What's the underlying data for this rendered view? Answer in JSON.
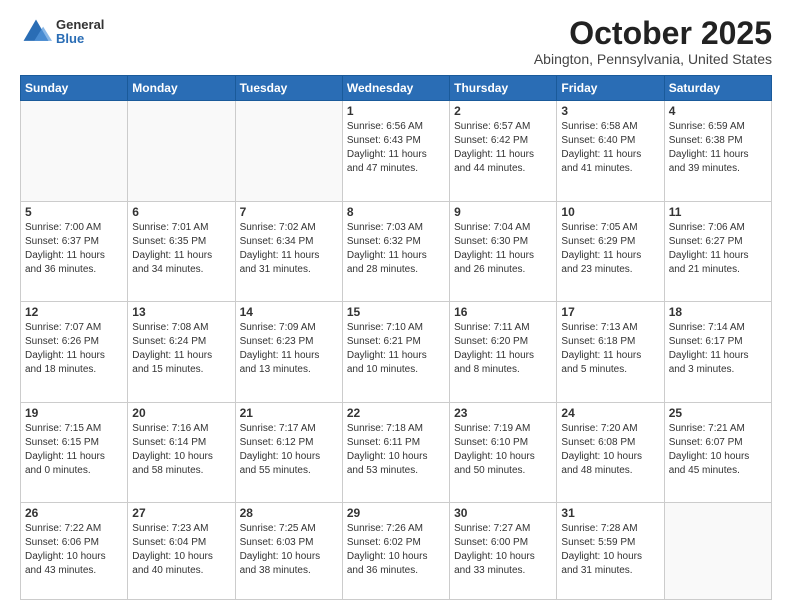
{
  "logo": {
    "general": "General",
    "blue": "Blue",
    "arrow_color": "#2a6db5"
  },
  "header": {
    "month": "October 2025",
    "location": "Abington, Pennsylvania, United States"
  },
  "weekdays": [
    "Sunday",
    "Monday",
    "Tuesday",
    "Wednesday",
    "Thursday",
    "Friday",
    "Saturday"
  ],
  "weeks": [
    [
      {
        "day": "",
        "info": ""
      },
      {
        "day": "",
        "info": ""
      },
      {
        "day": "",
        "info": ""
      },
      {
        "day": "1",
        "info": "Sunrise: 6:56 AM\nSunset: 6:43 PM\nDaylight: 11 hours\nand 47 minutes."
      },
      {
        "day": "2",
        "info": "Sunrise: 6:57 AM\nSunset: 6:42 PM\nDaylight: 11 hours\nand 44 minutes."
      },
      {
        "day": "3",
        "info": "Sunrise: 6:58 AM\nSunset: 6:40 PM\nDaylight: 11 hours\nand 41 minutes."
      },
      {
        "day": "4",
        "info": "Sunrise: 6:59 AM\nSunset: 6:38 PM\nDaylight: 11 hours\nand 39 minutes."
      }
    ],
    [
      {
        "day": "5",
        "info": "Sunrise: 7:00 AM\nSunset: 6:37 PM\nDaylight: 11 hours\nand 36 minutes."
      },
      {
        "day": "6",
        "info": "Sunrise: 7:01 AM\nSunset: 6:35 PM\nDaylight: 11 hours\nand 34 minutes."
      },
      {
        "day": "7",
        "info": "Sunrise: 7:02 AM\nSunset: 6:34 PM\nDaylight: 11 hours\nand 31 minutes."
      },
      {
        "day": "8",
        "info": "Sunrise: 7:03 AM\nSunset: 6:32 PM\nDaylight: 11 hours\nand 28 minutes."
      },
      {
        "day": "9",
        "info": "Sunrise: 7:04 AM\nSunset: 6:30 PM\nDaylight: 11 hours\nand 26 minutes."
      },
      {
        "day": "10",
        "info": "Sunrise: 7:05 AM\nSunset: 6:29 PM\nDaylight: 11 hours\nand 23 minutes."
      },
      {
        "day": "11",
        "info": "Sunrise: 7:06 AM\nSunset: 6:27 PM\nDaylight: 11 hours\nand 21 minutes."
      }
    ],
    [
      {
        "day": "12",
        "info": "Sunrise: 7:07 AM\nSunset: 6:26 PM\nDaylight: 11 hours\nand 18 minutes."
      },
      {
        "day": "13",
        "info": "Sunrise: 7:08 AM\nSunset: 6:24 PM\nDaylight: 11 hours\nand 15 minutes."
      },
      {
        "day": "14",
        "info": "Sunrise: 7:09 AM\nSunset: 6:23 PM\nDaylight: 11 hours\nand 13 minutes."
      },
      {
        "day": "15",
        "info": "Sunrise: 7:10 AM\nSunset: 6:21 PM\nDaylight: 11 hours\nand 10 minutes."
      },
      {
        "day": "16",
        "info": "Sunrise: 7:11 AM\nSunset: 6:20 PM\nDaylight: 11 hours\nand 8 minutes."
      },
      {
        "day": "17",
        "info": "Sunrise: 7:13 AM\nSunset: 6:18 PM\nDaylight: 11 hours\nand 5 minutes."
      },
      {
        "day": "18",
        "info": "Sunrise: 7:14 AM\nSunset: 6:17 PM\nDaylight: 11 hours\nand 3 minutes."
      }
    ],
    [
      {
        "day": "19",
        "info": "Sunrise: 7:15 AM\nSunset: 6:15 PM\nDaylight: 11 hours\nand 0 minutes."
      },
      {
        "day": "20",
        "info": "Sunrise: 7:16 AM\nSunset: 6:14 PM\nDaylight: 10 hours\nand 58 minutes."
      },
      {
        "day": "21",
        "info": "Sunrise: 7:17 AM\nSunset: 6:12 PM\nDaylight: 10 hours\nand 55 minutes."
      },
      {
        "day": "22",
        "info": "Sunrise: 7:18 AM\nSunset: 6:11 PM\nDaylight: 10 hours\nand 53 minutes."
      },
      {
        "day": "23",
        "info": "Sunrise: 7:19 AM\nSunset: 6:10 PM\nDaylight: 10 hours\nand 50 minutes."
      },
      {
        "day": "24",
        "info": "Sunrise: 7:20 AM\nSunset: 6:08 PM\nDaylight: 10 hours\nand 48 minutes."
      },
      {
        "day": "25",
        "info": "Sunrise: 7:21 AM\nSunset: 6:07 PM\nDaylight: 10 hours\nand 45 minutes."
      }
    ],
    [
      {
        "day": "26",
        "info": "Sunrise: 7:22 AM\nSunset: 6:06 PM\nDaylight: 10 hours\nand 43 minutes."
      },
      {
        "day": "27",
        "info": "Sunrise: 7:23 AM\nSunset: 6:04 PM\nDaylight: 10 hours\nand 40 minutes."
      },
      {
        "day": "28",
        "info": "Sunrise: 7:25 AM\nSunset: 6:03 PM\nDaylight: 10 hours\nand 38 minutes."
      },
      {
        "day": "29",
        "info": "Sunrise: 7:26 AM\nSunset: 6:02 PM\nDaylight: 10 hours\nand 36 minutes."
      },
      {
        "day": "30",
        "info": "Sunrise: 7:27 AM\nSunset: 6:00 PM\nDaylight: 10 hours\nand 33 minutes."
      },
      {
        "day": "31",
        "info": "Sunrise: 7:28 AM\nSunset: 5:59 PM\nDaylight: 10 hours\nand 31 minutes."
      },
      {
        "day": "",
        "info": ""
      }
    ]
  ]
}
